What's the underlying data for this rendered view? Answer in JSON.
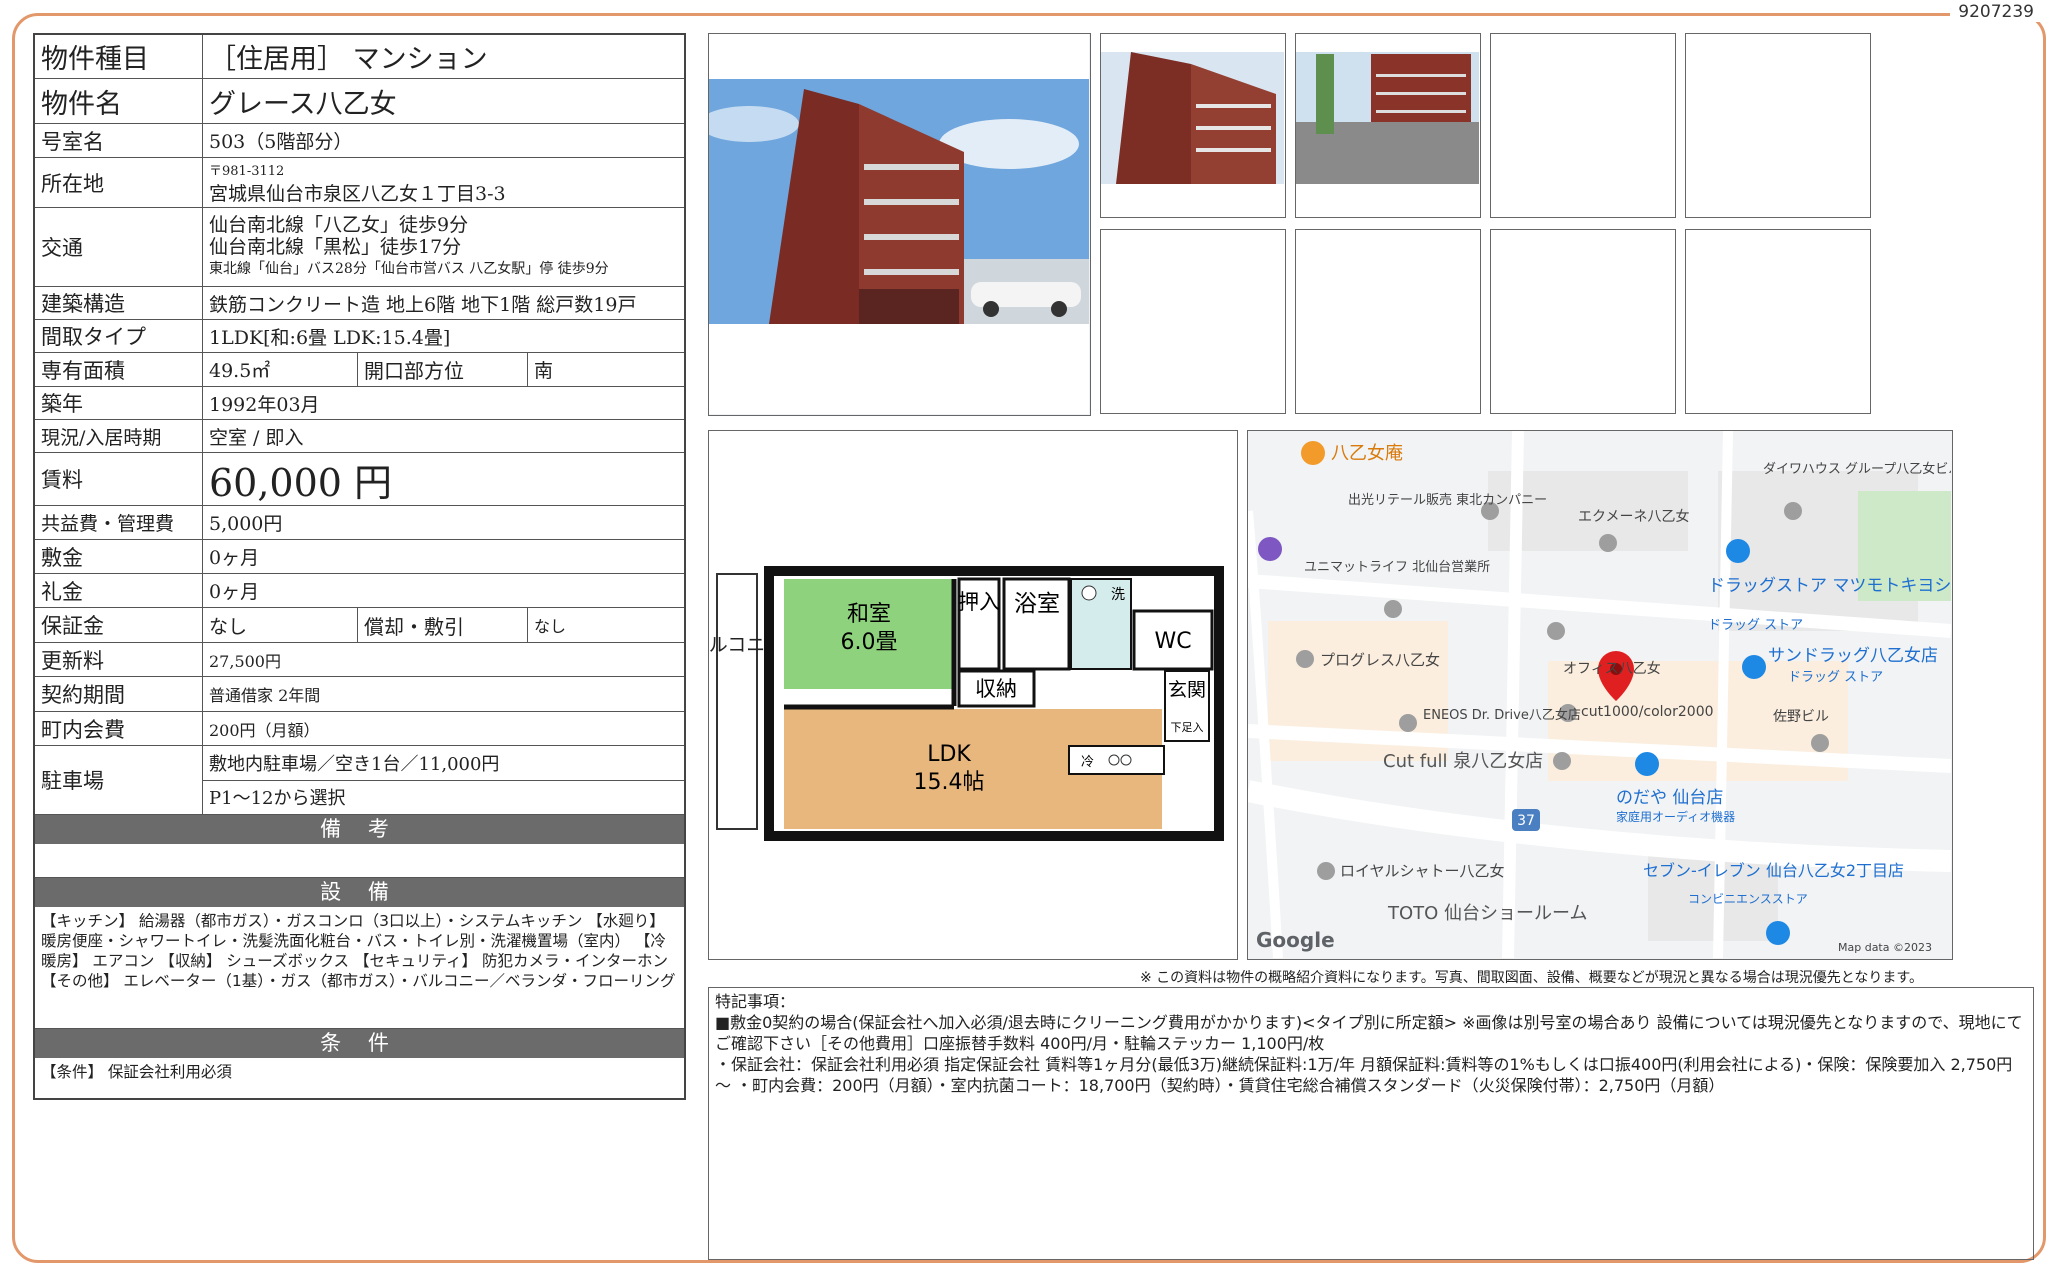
{
  "doc_id": "9207239",
  "spec": {
    "type": {
      "label": "物件種目",
      "value": "［住居用］ マンション"
    },
    "name": {
      "label": "物件名",
      "value": "グレース八乙女"
    },
    "room": {
      "label": "号室名",
      "value": "503（5階部分）"
    },
    "address": {
      "label": "所在地",
      "zip": "〒981-3112",
      "value": "宮城県仙台市泉区八乙女１丁目3-3"
    },
    "access": {
      "label": "交通",
      "line1": "仙台南北線「八乙女」徒歩9分",
      "line2": "仙台南北線「黒松」徒歩17分",
      "line3": "東北線「仙台」バス28分「仙台市営バス 八乙女駅」停 徒歩9分"
    },
    "structure": {
      "label": "建築構造",
      "value": "鉄筋コンクリート造 地上6階 地下1階 総戸数19戸"
    },
    "layout": {
      "label": "間取タイプ",
      "value": "1LDK[和:6畳 LDK:15.4畳]"
    },
    "area": {
      "label": "専有面積",
      "value": "49.5㎡",
      "dir_label": "開口部方位",
      "dir_value": "南"
    },
    "built": {
      "label": "築年",
      "value": "1992年03月"
    },
    "status": {
      "label": "現況/入居時期",
      "value": "空室 / 即入"
    },
    "rent": {
      "label": "賃料",
      "value": "60,000 円"
    },
    "fee": {
      "label": "共益費・管理費",
      "value": "5,000円"
    },
    "deposit": {
      "label": "敷金",
      "value": "0ヶ月"
    },
    "key_money": {
      "label": "礼金",
      "value": "0ヶ月"
    },
    "guarantee": {
      "label": "保証金",
      "value": "なし",
      "amort_label": "償却・敷引",
      "amort_value": "なし"
    },
    "renewal": {
      "label": "更新料",
      "value": "27,500円"
    },
    "contract": {
      "label": "契約期間",
      "value": "普通借家 2年間"
    },
    "community": {
      "label": "町内会費",
      "value": "200円（月額）"
    },
    "parking": {
      "label": "駐車場",
      "value1": "敷地内駐車場／空き1台／11,000円",
      "value2": "P1～12から選択"
    }
  },
  "remarks_title": "備 考",
  "equipment_title": "設 備",
  "equipment_text": "【キッチン】 給湯器（都市ガス）・ガスコンロ（3口以上）・システムキッチン 【水廻り】 暖房便座・シャワートイレ・洗髪洗面化粧台・バス・トイレ別・洗濯機置場（室内） 【冷暖房】 エアコン 【収納】 シューズボックス 【セキュリティ】 防犯カメラ・インターホン 【その他】 エレベーター（1基）・ガス（都市ガス）・バルコニー／ベランダ・フローリング",
  "conditions_title": "条 件",
  "conditions_text": "【条件】 保証会社利用必須",
  "floorplan": {
    "balcony": "バルコニー",
    "washitsu": "和室",
    "washitsu_size": "6.0畳",
    "oshiire": "押入",
    "bath": "浴室",
    "wash": "洗",
    "wc": "WC",
    "storage": "収納",
    "entrance": "玄関",
    "shoebox": "下足入",
    "ldk": "LDK",
    "ldk_size": "15.4帖",
    "fridge": "冷"
  },
  "map": {
    "labels": [
      "八乙女庵",
      "出光リテール販売 東北カンパニー",
      "エクメーネ八乙女",
      "ダイワハウス グループ八乙女ビル",
      "ユニマットライフ 北仙台営業所",
      "ドラッグストア マツモトキヨシ 八乙女店",
      "ドラッグ ストア",
      "プログレス八乙女",
      "オフィス八乙女",
      "サンドラッグ八乙女店",
      "ドラッグ ストア",
      "ENEOS Dr. Drive八乙女店",
      "cut1000/color2000",
      "佐野ビル",
      "Cut full 泉八乙女店",
      "のだや 仙台店",
      "家庭用オーディオ機器",
      "37",
      "ロイヤルシャトー八乙女",
      "セブン-イレブン 仙台八乙女2丁目店",
      "コンビニエンスストア",
      "TOTO 仙台ショールーム"
    ],
    "google": "Google",
    "attribution": "Map data ©2023"
  },
  "disclaimer": "※ この資料は物件の概略紹介資料になります。写真、間取図面、設備、概要などが現況と異なる場合は現況優先となります。",
  "notes": {
    "title": "特記事項：",
    "line1": "■敷金0契約の場合(保証会社へ加入必須/退去時にクリーニング費用がかかります)<タイプ別に所定額> ※画像は別号室の場合あり 設備については現況優先となりますので、現地にてご確認下さい［その他費用］口座振替手数料 400円/月・駐輪ステッカー 1,100円/枚",
    "line2": "・保証会社：保証会社利用必須 指定保証会社 賃料等1ヶ月分(最低3万)継続保証料:1万/年 月額保証料:賃料等の1%もしくは口振400円(利用会社による)・保険：保険要加入 2,750円 ～ ・町内会費：200円（月額）・室内抗菌コート：18,700円（契約時）・賃貸住宅総合補償スタンダード（火災保険付帯）：2,750円（月額）"
  },
  "colors": {
    "frame": "#e2986a",
    "bar": "#6b6b6b",
    "washitsu": "#8fd27d",
    "ldk": "#e8b77e",
    "pin": "#e02020"
  }
}
